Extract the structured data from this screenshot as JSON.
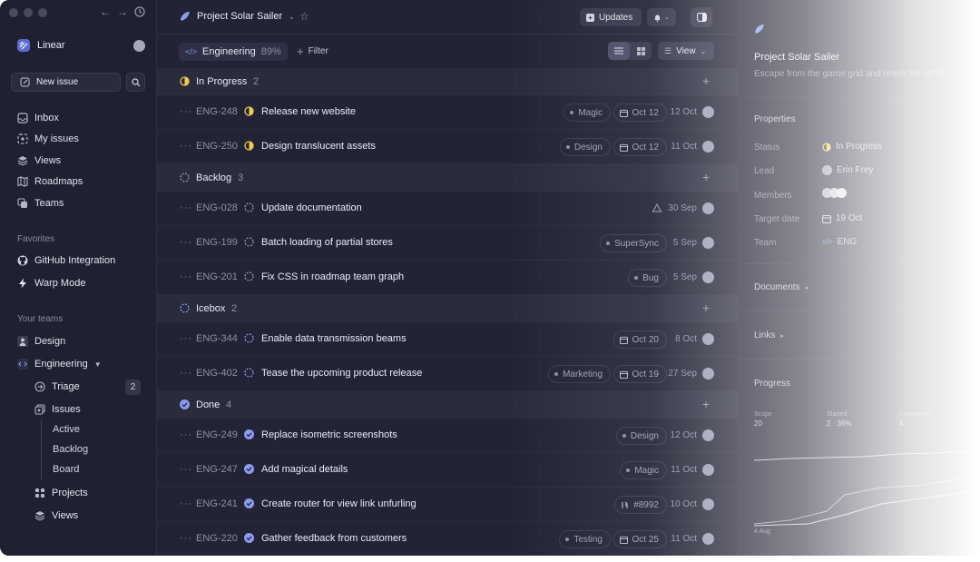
{
  "sidebar": {
    "workspace": "Linear",
    "new_issue": "New issue",
    "nav": [
      {
        "label": "Inbox",
        "icon": "inbox-icon"
      },
      {
        "label": "My issues",
        "icon": "my-issues-icon"
      },
      {
        "label": "Views",
        "icon": "views-icon"
      },
      {
        "label": "Roadmaps",
        "icon": "roadmaps-icon"
      },
      {
        "label": "Teams",
        "icon": "teams-icon"
      }
    ],
    "favorites_label": "Favorites",
    "favorites": [
      {
        "label": "GitHub Integration",
        "icon": "github-icon"
      },
      {
        "label": "Warp Mode",
        "icon": "bolt-icon"
      }
    ],
    "teams_label": "Your teams",
    "teams": [
      {
        "label": "Design",
        "icon": "design-team-icon"
      },
      {
        "label": "Engineering",
        "icon": "engineering-team-icon"
      }
    ],
    "eng_items": [
      {
        "label": "Triage",
        "count": "2"
      },
      {
        "label": "Issues"
      },
      {
        "label": "Projects"
      },
      {
        "label": "Views"
      }
    ],
    "issue_sub": [
      "Active",
      "Backlog",
      "Board"
    ]
  },
  "header": {
    "project": "Project Solar Sailer",
    "updates": "Updates"
  },
  "toolbar": {
    "team": "Engineering",
    "percent": "89%",
    "filter": "Filter",
    "view": "View"
  },
  "groups": [
    {
      "label": "In Progress",
      "count": "2",
      "status": "in-progress"
    },
    {
      "label": "Backlog",
      "count": "3",
      "status": "backlog"
    },
    {
      "label": "Icebox",
      "count": "2",
      "status": "icebox"
    },
    {
      "label": "Done",
      "count": "4",
      "status": "done"
    }
  ],
  "issues": [
    {
      "id": "ENG-248",
      "title": "Release new website",
      "label": "Magic",
      "due": "Oct 12",
      "date": "12 Oct",
      "status": "in-progress"
    },
    {
      "id": "ENG-250",
      "title": "Design translucent assets",
      "label": "Design",
      "due": "Oct 12",
      "date": "11 Oct",
      "status": "in-progress"
    },
    {
      "id": "ENG-028",
      "title": "Update documentation",
      "label": "",
      "due": "",
      "date": "30 Sep",
      "status": "backlog"
    },
    {
      "id": "ENG-199",
      "title": "Batch loading of partial stores",
      "label": "SuperSync",
      "due": "",
      "date": "5 Sep",
      "status": "backlog"
    },
    {
      "id": "ENG-201",
      "title": "Fix CSS in roadmap team graph",
      "label": "Bug",
      "due": "",
      "date": "5 Sep",
      "status": "backlog"
    },
    {
      "id": "ENG-344",
      "title": "Enable data transmission beams",
      "label": "",
      "due": "Oct 20",
      "date": "8 Oct",
      "status": "icebox"
    },
    {
      "id": "ENG-402",
      "title": "Tease the upcoming product release",
      "label": "Marketing",
      "due": "Oct 19",
      "date": "27 Sep",
      "status": "icebox"
    },
    {
      "id": "ENG-249",
      "title": "Replace isometric screenshots",
      "label": "Design",
      "due": "",
      "date": "12 Oct",
      "status": "done"
    },
    {
      "id": "ENG-247",
      "title": "Add magical details",
      "label": "Magic",
      "due": "",
      "date": "11 Oct",
      "status": "done"
    },
    {
      "id": "ENG-241",
      "title": "Create router for view link unfurling",
      "label": "#8992",
      "due": "",
      "date": "10 Oct",
      "status": "done"
    },
    {
      "id": "ENG-220",
      "title": "Gather feedback from customers",
      "label": "Testing",
      "due": "Oct 25",
      "date": "11 Oct",
      "status": "done"
    }
  ],
  "panel": {
    "title": "Project Solar Sailer",
    "subtitle": "Escape from the game grid and reach the MCP",
    "properties_label": "Properties",
    "props": [
      {
        "label": "Status",
        "value": "In Progress"
      },
      {
        "label": "Lead",
        "value": "Erin Frey"
      },
      {
        "label": "Members",
        "value": ""
      },
      {
        "label": "Target date",
        "value": "19 Oct"
      },
      {
        "label": "Team",
        "value": "ENG"
      }
    ],
    "documents": "Documents",
    "links": "Links",
    "progress": "Progress",
    "progress_stats": [
      {
        "label": "Scope",
        "value": "20"
      },
      {
        "label": "Started",
        "value": "2 · 36%"
      },
      {
        "label": "Completed",
        "value": "4"
      }
    ],
    "chart_start": "4 Aug"
  }
}
